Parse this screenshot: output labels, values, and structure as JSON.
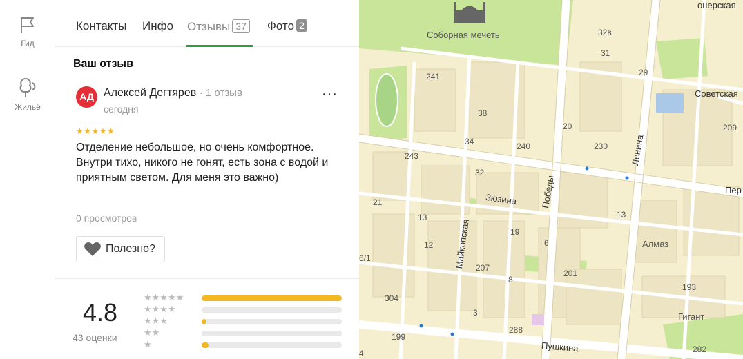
{
  "rail": {
    "guide_label": "Гид",
    "housing_label": "Жильё"
  },
  "tabs": {
    "contacts": "Контакты",
    "info": "Инфо",
    "reviews": "Отзывы",
    "reviews_count": "37",
    "photos": "Фото",
    "photos_count": "2"
  },
  "review": {
    "heading": "Ваш отзыв",
    "avatar_initials": "АД",
    "author": "Алексей Дегтярев",
    "author_reviews": "· 1 отзыв",
    "date": "сегодня",
    "stars": "★★★★★",
    "rating": 5,
    "more": "···",
    "text": "Отделение небольшое, но очень комфортное. Внутри тихо, никого не гонят, есть зона с водой и приятным светом. Для меня это важно)",
    "views": "0 просмотров",
    "useful": "Полезно?"
  },
  "summary": {
    "rating": "4.8",
    "count_label": "43 оценки",
    "distribution": [
      {
        "stars": "★★★★★",
        "fraction": 1.0
      },
      {
        "stars": "★★★★",
        "fraction": 0.0
      },
      {
        "stars": "★★★",
        "fraction": 0.03
      },
      {
        "stars": "★★",
        "fraction": 0.0
      },
      {
        "stars": "★",
        "fraction": 0.05
      }
    ]
  },
  "map": {
    "poi_mosque": "Соборная мечеть",
    "poi_almaz": "Алмаз",
    "poi_gigant": "Гигант",
    "streets": {
      "sovetskaya": "Советская",
      "lenina": "Ленина",
      "zyuzina": "Зюзина",
      "pobedy": "Победы",
      "maykopskaya": "Майкопская",
      "pushkina": "Пушкина",
      "pioneer": "онерская",
      "per": "Пер"
    },
    "numbers": [
      "32в",
      "31",
      "29",
      "241",
      "38",
      "20",
      "209",
      "34",
      "240",
      "230",
      "243",
      "32",
      "21",
      "13",
      "19",
      "13",
      "12",
      "6",
      "207",
      "201",
      "8",
      "304",
      "3",
      "193",
      "288",
      "199",
      "282",
      "6/1",
      "4"
    ]
  },
  "colors": {
    "accent_green": "#29a039",
    "star": "#f5b720",
    "avatar": "#e42f39",
    "map_bg": "#f5eecf",
    "park": "#c9e59a",
    "road": "#ffffff"
  }
}
